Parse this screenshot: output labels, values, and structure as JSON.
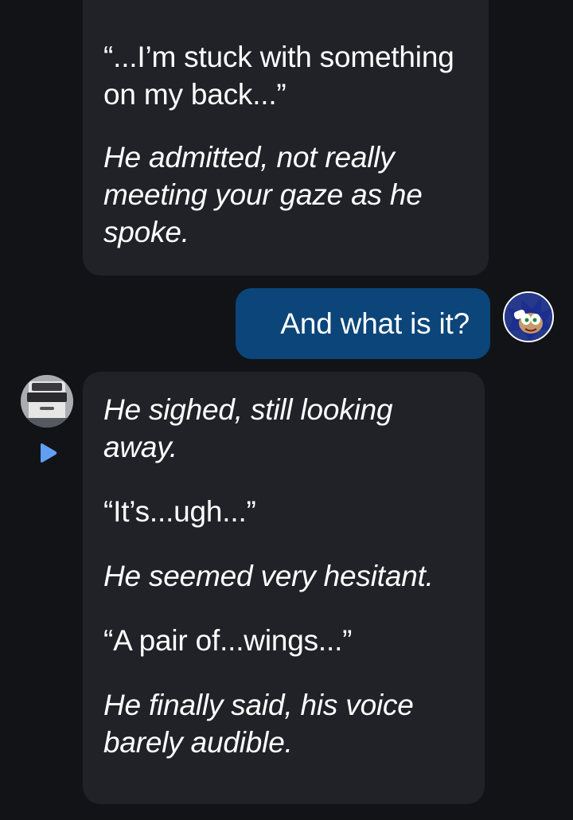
{
  "messages": [
    {
      "role": "character",
      "paragraphs": [
        {
          "text": "“...I’m stuck with something on my back...”",
          "style": "normal"
        },
        {
          "text": "He admitted, not really meeting your gaze as he spoke.",
          "style": "italic"
        }
      ]
    },
    {
      "role": "user",
      "text": "And what is it?"
    },
    {
      "role": "character",
      "paragraphs": [
        {
          "text": "He sighed, still looking away.",
          "style": "italic"
        },
        {
          "text": "“It’s...ugh...”",
          "style": "normal"
        },
        {
          "text": "He seemed very hesitant.",
          "style": "italic"
        },
        {
          "text": "“A pair of...wings...”",
          "style": "normal"
        },
        {
          "text": "He finally said, his voice barely audible.",
          "style": "italic"
        }
      ]
    }
  ],
  "colors": {
    "background": "#121317",
    "character_bubble": "#202228",
    "user_bubble": "#0b4579",
    "text": "#ffffff",
    "play_icon": "#5fa0f2"
  },
  "icons": {
    "play": "play-triangle-icon"
  }
}
